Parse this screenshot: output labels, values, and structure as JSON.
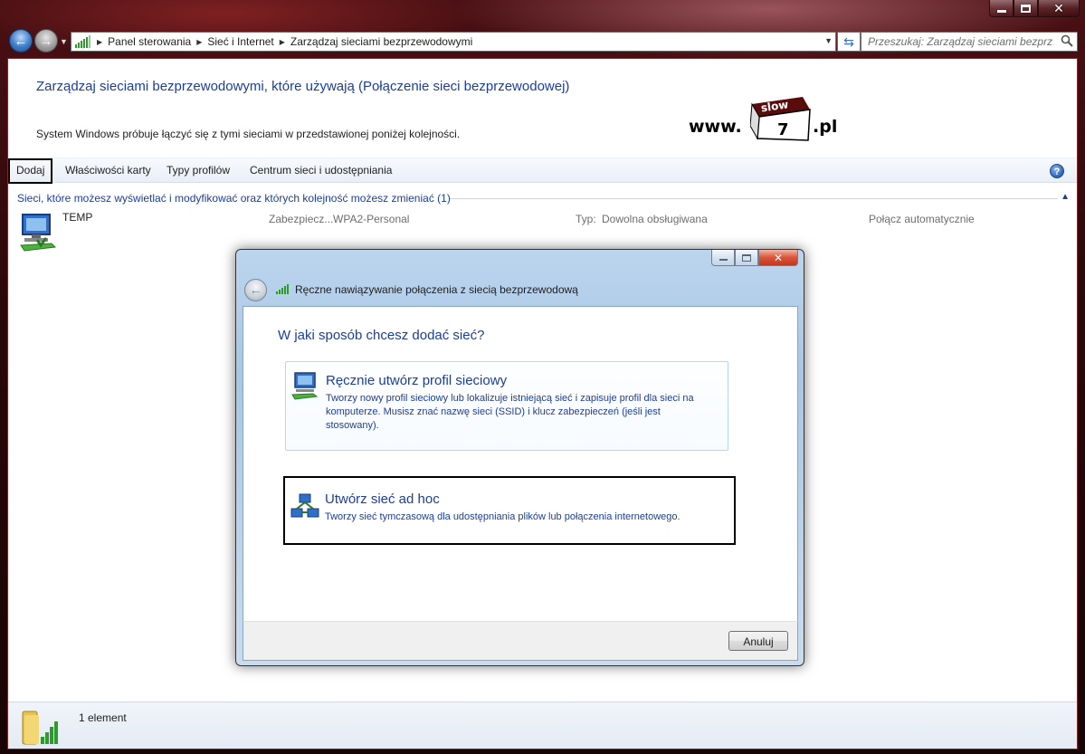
{
  "window": {
    "caption": {
      "minimize_icon": "minimize-icon",
      "maximize_icon": "maximize-icon",
      "close_icon": "close-icon"
    }
  },
  "nav": {
    "breadcrumbs": [
      "Panel sterowania",
      "Sieć i Internet",
      "Zarządzaj sieciami bezprzewodowymi"
    ],
    "search_placeholder": "Przeszukaj: Zarządzaj sieciami bezprz..."
  },
  "main": {
    "heading": "Zarządzaj sieciami bezprzewodowymi, które używają (Połączenie sieci bezprzewodowej)",
    "description": "System Windows próbuje łączyć się z tymi sieciami w przedstawionej poniżej kolejności.",
    "logo": {
      "www": "www.",
      "book_top": "slow",
      "book_num": "7",
      "pl": ".pl"
    }
  },
  "toolbar": {
    "items": [
      "Dodaj",
      "Właściwości karty",
      "Typy profilów",
      "Centrum sieci i udostępniania"
    ]
  },
  "group": {
    "header": "Sieci, które możesz wyświetlać i modyfikować oraz których kolejność możesz zmieniać (1)"
  },
  "network": {
    "name": "TEMP",
    "security_label": "Zabezpiecz...",
    "security_value": "WPA2-Personal",
    "type_label": "Typ:",
    "type_value": "Dowolna obsługiwana",
    "auto": "Połącz automatycznie"
  },
  "status": {
    "count": "1 element"
  },
  "dialog": {
    "title": "Ręczne nawiązywanie połączenia z siecią bezprzewodową",
    "question": "W jaki sposób chcesz dodać sieć?",
    "options": [
      {
        "title": "Ręcznie utwórz profil sieciowy",
        "desc": "Tworzy nowy profil sieciowy lub lokalizuje istniejącą sieć i zapisuje profil dla sieci na komputerze. Musisz znać nazwę sieci (SSID) i klucz zabezpieczeń (jeśli jest stosowany)."
      },
      {
        "title": "Utwórz sieć ad hoc",
        "desc": "Tworzy sieć tymczasową dla  udostępniania plików lub połączenia internetowego."
      }
    ],
    "cancel_label": "Anuluj"
  },
  "colors": {
    "link_blue": "#1a3e9c",
    "aero_red": "#4a1014"
  }
}
